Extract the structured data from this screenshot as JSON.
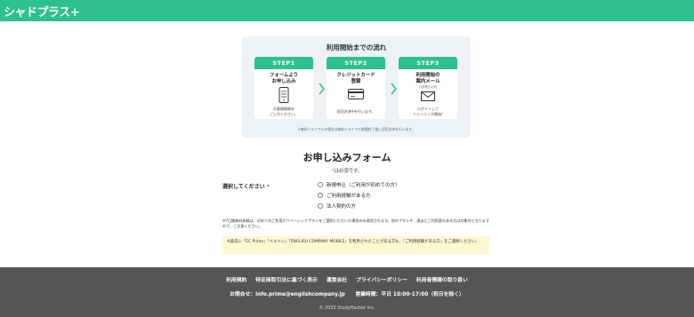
{
  "header": {
    "logo_text": "シャドプラス+",
    "bg_color": "#2fc08f"
  },
  "flow": {
    "title": "利用開始までの流れ",
    "steps": [
      {
        "label": "STEP1",
        "title": "フォームより\nお申し込み",
        "sub": "",
        "desc": "お客様情報を\nご入力ください。",
        "icon": "phone-form-icon"
      },
      {
        "label": "STEP2",
        "title": "クレジットカード\n登録",
        "sub": "",
        "desc": "初回決済※を行います。",
        "icon": "credit-card-icon"
      },
      {
        "label": "STEP3",
        "title": "利用開始の\n案内メール",
        "sub": "(1営業日以内)",
        "desc": "ログインして\nトレーニング開始!",
        "icon": "mail-icon"
      }
    ],
    "note": "※無料トライアルの場合は無料トライアル期間終了後に初回決済を行います。"
  },
  "form": {
    "title": "お申し込みフォーム",
    "required_mark": "*",
    "required_text": "は必須です。",
    "select_label": "選択してください",
    "options": [
      "新規申込（ご利用が初めての方）",
      "ご利用経験がある方",
      "法人契約の方"
    ],
    "notice": "※7日間無料体験は、初めてのご利用かつベーシックプランをご選択いただいた場合のみ適用されます。他のプランや、過去にご利用歴のある方は対象外となりますので、ご注意ください。",
    "highlight": "※過去に「EC Prime」「イエトレ」「ENGLISH COMPANY MOBILE」を利用されたことがある方も、「ご利用経験がある方」をご選択ください。"
  },
  "footer": {
    "links": [
      "利用規約",
      "特定商取引法に基づく表示",
      "運営会社",
      "プライバシーポリシー",
      "利用者情報の取り扱い"
    ],
    "contact": "お問合せ：info.prime@englishcompany.jp　　営業時間：平日 10:00-17:00（祝日を除く）",
    "copyright": "© 2025 StudyHacker Inc."
  },
  "colors": {
    "accent": "#2fc08f",
    "footer_bg": "#555555",
    "highlight_bg": "#fdf8d2"
  }
}
